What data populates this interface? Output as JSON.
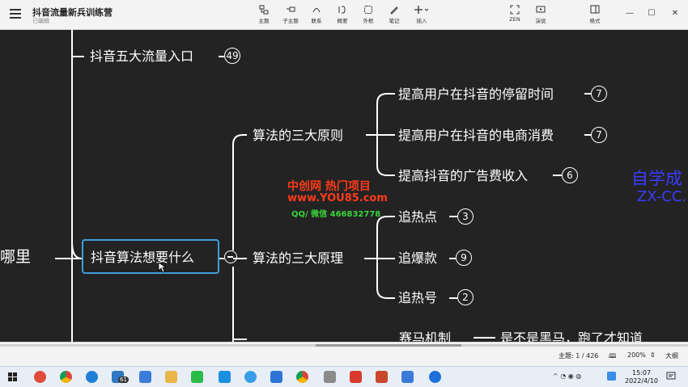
{
  "app": {
    "title": "抖音流量新兵训练营",
    "subtitle": "已编辑"
  },
  "toolbar": [
    {
      "label": "主题",
      "icon": "topic-icon"
    },
    {
      "label": "子主题",
      "icon": "subtopic-icon"
    },
    {
      "label": "联系",
      "icon": "relationship-icon"
    },
    {
      "label": "概要",
      "icon": "summary-icon"
    },
    {
      "label": "外框",
      "icon": "boundary-icon"
    },
    {
      "label": "笔记",
      "icon": "note-icon"
    },
    {
      "label": "插入",
      "icon": "insert-icon"
    },
    {
      "label": "ZEN",
      "icon": "zen-icon"
    },
    {
      "label": "演说",
      "icon": "pitch-icon"
    },
    {
      "label": "格式",
      "icon": "format-icon"
    }
  ],
  "mindmap": {
    "root_partial": "哪里",
    "flow_entry": {
      "label": "抖音五大流量入口",
      "count": "49"
    },
    "selected": "抖音算法想要什么",
    "principles": {
      "label": "算法的三大原则",
      "children": [
        {
          "label": "提高用户在抖音的停留时间",
          "count": "7"
        },
        {
          "label": "提高用户在抖音的电商消费",
          "count": "7"
        },
        {
          "label": "提高抖音的广告费收入",
          "count": "6"
        }
      ]
    },
    "mechanisms": {
      "label": "算法的三大原理",
      "children": [
        {
          "label": "追热点",
          "count": "3"
        },
        {
          "label": "追爆款",
          "count": "9"
        },
        {
          "label": "追热号",
          "count": "2"
        }
      ]
    },
    "cutoff": {
      "label": "赛马机制",
      "child": "是不是黑马，跑了才知道"
    }
  },
  "watermark": {
    "line1": "中创网 热门项目",
    "line2": "www.YOU85.com",
    "line3": "QQ/ 微信 466832778",
    "brand1": "自学成",
    "brand2": "ZX-CC."
  },
  "status": {
    "topics": "主题: 1 / 426",
    "zoom": "200%",
    "outline": "大纲"
  },
  "clock": {
    "time": "15:07",
    "date": "2022/4/10"
  },
  "taskbar_badge": "61"
}
